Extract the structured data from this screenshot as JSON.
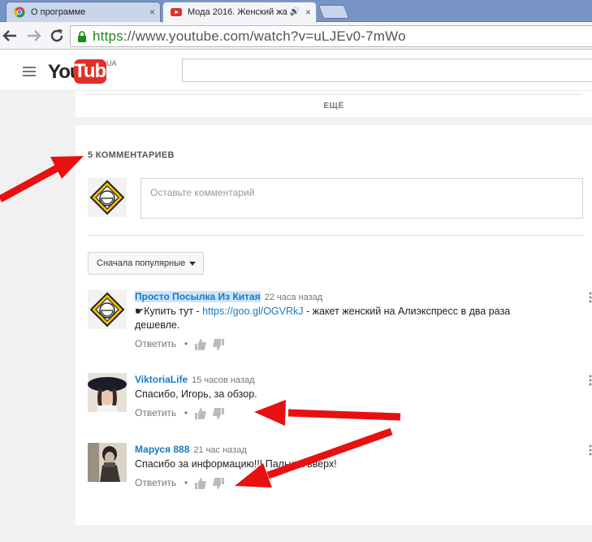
{
  "browser": {
    "tabs": [
      {
        "title": "О программе",
        "close": "×"
      },
      {
        "title": "Мода 2016. Женский жа",
        "close": "×",
        "audio": "🔊"
      }
    ],
    "url_scheme": "https",
    "url_rest": "://www.youtube.com/watch?v=uLJEv0-7mWo"
  },
  "header": {
    "logo_you": "You",
    "logo_tube": "Tube",
    "region": "UA"
  },
  "description": {
    "more_label": "ЕЩЁ"
  },
  "comments": {
    "count_label": "5 КОММЕНТАРИЕВ",
    "placeholder": "Оставьте комментарий",
    "sort_label": "Сначала популярные",
    "items": [
      {
        "author": "Просто Посылка Из Китая",
        "time": "22 часа назад",
        "text_prefix": "☛Купить тут - ",
        "link": "https://goo.gl/OGVRkJ",
        "text_suffix": " - жакет женский на Алиэкспресс в два раза дешевле.",
        "reply": "Ответить",
        "dot": "•"
      },
      {
        "author": "ViktoriaLife",
        "time": "15 часов назад",
        "text": "Спасибо, Игорь, за обзор.",
        "reply": "Ответить",
        "dot": "•"
      },
      {
        "author": "Маруся 888",
        "time": "21 час назад",
        "text": "Спасибо за информацию!!! Пальчик вверх!",
        "reply": "Ответить",
        "dot": "•"
      }
    ]
  },
  "colors": {
    "link": "#167ac6",
    "arrow": "#e81010",
    "yt_red": "#e52d27"
  }
}
